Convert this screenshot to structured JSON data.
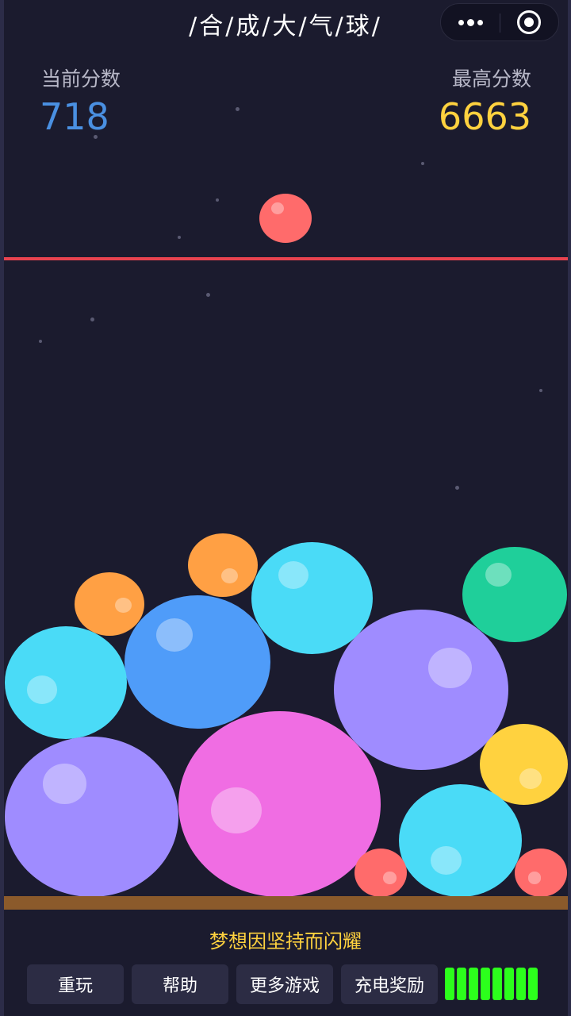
{
  "header": {
    "title": "/合/成/大/气/球/",
    "capsule": {
      "more_icon": "more-dots-icon",
      "close_icon": "target-circle-icon"
    }
  },
  "score": {
    "current_label": "当前分数",
    "current_value": "718",
    "best_label": "最高分数",
    "best_value": "6663",
    "current_color": "#4a90e2",
    "best_color": "#ffd23f"
  },
  "game": {
    "danger_line_color": "#e8434f",
    "next_ball_color": "#ff6b6b",
    "ball_colors": {
      "red": "#ff6b6b",
      "orange": "#ffa044",
      "yellow": "#ffd23f",
      "green": "#1fcf9a",
      "cyan": "#4adbf7",
      "blue": "#4f9cf9",
      "purple": "#9f8cff",
      "pink": "#f06de3"
    },
    "ground_color": "#8b5a2b"
  },
  "footer": {
    "motto": "梦想因坚持而闪耀",
    "buttons": [
      "重玩",
      "帮助",
      "更多游戏",
      "充电奖励"
    ],
    "battery_segments": 8,
    "battery_color": "#2cff1c"
  }
}
